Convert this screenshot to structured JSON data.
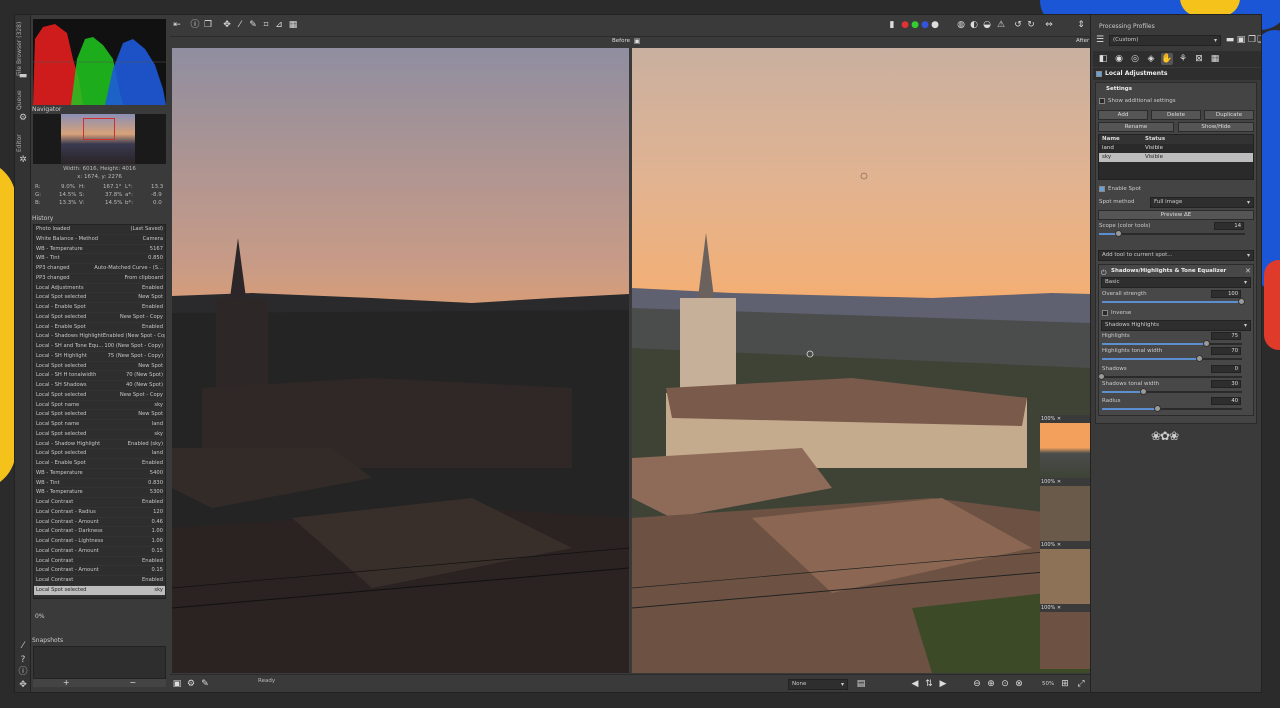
{
  "vertical_tabs": {
    "file_browser": "File Browser (328)",
    "queue": "Queue",
    "editor": "Editor"
  },
  "navigator": {
    "title": "Navigator",
    "dimensions": "Width: 6016, Height: 4016",
    "cursor": "x: 1674, y: 2276",
    "readout": {
      "r": "9.0%",
      "g": "14.5%",
      "b": "13.3%",
      "h": "167.1°",
      "s": "37.8%",
      "v": "14.5%",
      "l": "13.3",
      "a": "-8.9",
      "bstar": "0.0",
      "h_lbl": "H:",
      "s_lbl": "S:",
      "v_lbl": "V:",
      "r_lbl": "R:",
      "g_lbl": "G:",
      "b_lbl": "B:",
      "l_lbl": "L*:",
      "a_lbl": "a*:",
      "bs_lbl": "b*:"
    }
  },
  "history": {
    "title": "History",
    "items": [
      {
        "action": "Photo loaded",
        "value": "(Last Saved)"
      },
      {
        "action": "White Balance - Method",
        "value": "Camera"
      },
      {
        "action": "WB - Temperature",
        "value": "5167"
      },
      {
        "action": "WB - Tint",
        "value": "0.850"
      },
      {
        "action": "PP3 changed",
        "value": "Auto-Matched Curve - (S..."
      },
      {
        "action": "PP3 changed",
        "value": "From clipboard"
      },
      {
        "action": "Local Adjustments",
        "value": "Enabled"
      },
      {
        "action": "Local Spot selected",
        "value": "New Spot"
      },
      {
        "action": "Local - Enable Spot",
        "value": "Enabled"
      },
      {
        "action": "Local Spot selected",
        "value": "New Spot - Copy"
      },
      {
        "action": "Local - Enable Spot",
        "value": "Enabled"
      },
      {
        "action": "Local - Shadows Highlight",
        "value": "Enabled (New Spot - Copy)"
      },
      {
        "action": "Local - SH and Tone Equ...",
        "value": "100 (New Spot - Copy)"
      },
      {
        "action": "Local - SH Highlight",
        "value": "75 (New Spot - Copy)"
      },
      {
        "action": "Local Spot selected",
        "value": "New Spot"
      },
      {
        "action": "Local - SH H tonalwidth",
        "value": "70 (New Spot)"
      },
      {
        "action": "Local - SH Shadows",
        "value": "40 (New Spot)"
      },
      {
        "action": "Local Spot selected",
        "value": "New Spot - Copy"
      },
      {
        "action": "Local Spot name",
        "value": "sky"
      },
      {
        "action": "Local Spot selected",
        "value": "New Spot"
      },
      {
        "action": "Local Spot name",
        "value": "land"
      },
      {
        "action": "Local Spot selected",
        "value": "sky"
      },
      {
        "action": "Local - Shadow Highlight",
        "value": "Enabled (sky)"
      },
      {
        "action": "Local Spot selected",
        "value": "land"
      },
      {
        "action": "Local - Enable Spot",
        "value": "Enabled"
      },
      {
        "action": "WB - Temperature",
        "value": "5400"
      },
      {
        "action": "WB - Tint",
        "value": "0.830"
      },
      {
        "action": "WB - Temperature",
        "value": "5300"
      },
      {
        "action": "Local Contrast",
        "value": "Enabled"
      },
      {
        "action": "Local Contrast - Radius",
        "value": "120"
      },
      {
        "action": "Local Contrast - Amount",
        "value": "0.46"
      },
      {
        "action": "Local Contrast - Darkness",
        "value": "1.00"
      },
      {
        "action": "Local Contrast - Lightness",
        "value": "1.00"
      },
      {
        "action": "Local Contrast - Amount",
        "value": "0.15"
      },
      {
        "action": "Local Contrast",
        "value": "Enabled"
      },
      {
        "action": "Local Contrast - Amount",
        "value": "0.15"
      },
      {
        "action": "Local Contrast",
        "value": "Enabled"
      },
      {
        "action": "Local Spot selected",
        "value": "sky"
      }
    ]
  },
  "progress_label": "0%",
  "snapshots": {
    "title": "Snapshots",
    "add": "+",
    "remove": "−"
  },
  "views": {
    "before": "Before",
    "after": "After"
  },
  "bottom": {
    "status": "Ready",
    "preset": "None",
    "zoom": "50%"
  },
  "detail_zoom": "100%",
  "right": {
    "title": "Processing Profiles",
    "profile": "(Custom)",
    "local_adjustments": "Local Adjustments",
    "settings": "Settings",
    "show_additional": "Show additional settings",
    "buttons": {
      "add": "Add",
      "delete": "Delete",
      "duplicate": "Duplicate",
      "rename": "Rename",
      "show_hide": "Show/Hide"
    },
    "table": {
      "col_name": "Name",
      "col_status": "Status",
      "rows": [
        {
          "name": "land",
          "status": "Visible"
        },
        {
          "name": "sky",
          "status": "Visible"
        }
      ]
    },
    "enable_spot": "Enable Spot",
    "spot_method_label": "Spot method",
    "spot_method": "Full image",
    "preview_de": "Preview ΔE",
    "scope_label": "Scope (color tools)",
    "scope_val": "14",
    "scope_pct": 14,
    "add_tool": "Add tool to current spot...",
    "tool_title": "Shadows/Highlights & Tone Equalizer",
    "mode": "Basic",
    "overall_label": "Overall strength",
    "overall_val": "100",
    "overall_pct": 100,
    "inverse": "Inverse",
    "sh_method": "Shadows Highlights",
    "highlights_label": "Highlights",
    "highlights_val": "75",
    "highlights_pct": 75,
    "htw_label": "Highlights tonal width",
    "htw_val": "70",
    "htw_pct": 70,
    "shadows_label": "Shadows",
    "shadows_val": "0",
    "shadows_pct": 0,
    "stw_label": "Shadows tonal width",
    "stw_val": "30",
    "stw_pct": 30,
    "radius_label": "Radius",
    "radius_val": "40",
    "radius_pct": 40
  }
}
